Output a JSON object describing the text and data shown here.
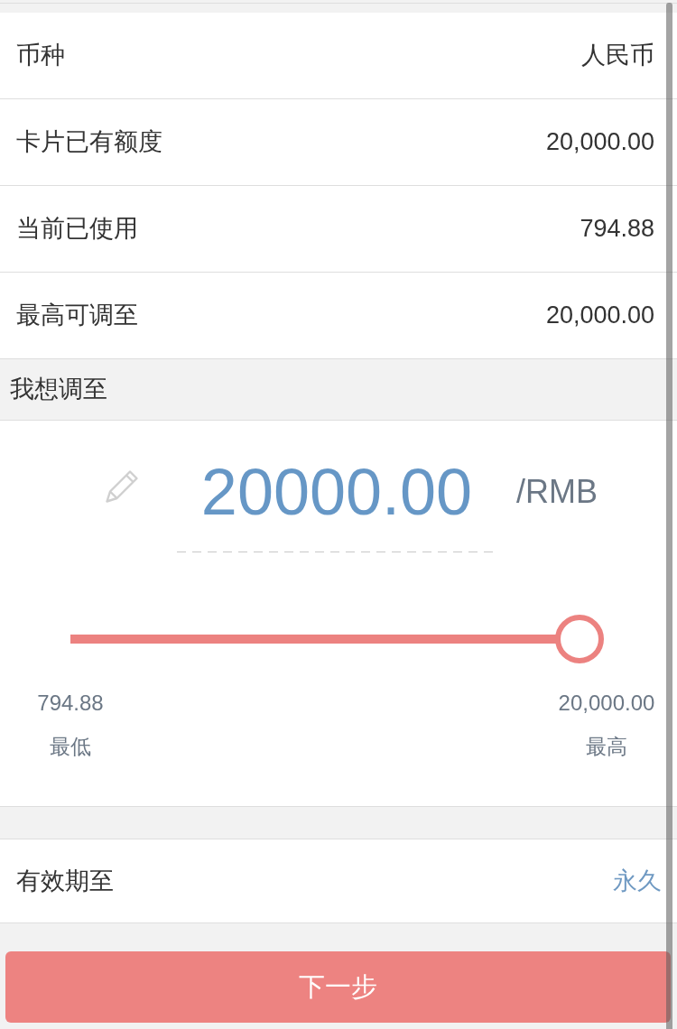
{
  "info_rows": [
    {
      "label": "币种",
      "value": "人民币"
    },
    {
      "label": "卡片已有额度",
      "value": "20,000.00"
    },
    {
      "label": "当前已使用",
      "value": "794.88"
    },
    {
      "label": "最高可调至",
      "value": "20,000.00"
    }
  ],
  "adjust": {
    "title": "我想调至",
    "amount": "20000.00",
    "unit": "/RMB",
    "slider": {
      "level": 1
    },
    "range": [
      {
        "value": "794.88",
        "label": "最低"
      },
      {
        "value": "20,000.00",
        "label": "最高"
      }
    ]
  },
  "validity": {
    "label": "有效期至",
    "value": "永久"
  },
  "next_button": {
    "label": "下一步"
  }
}
